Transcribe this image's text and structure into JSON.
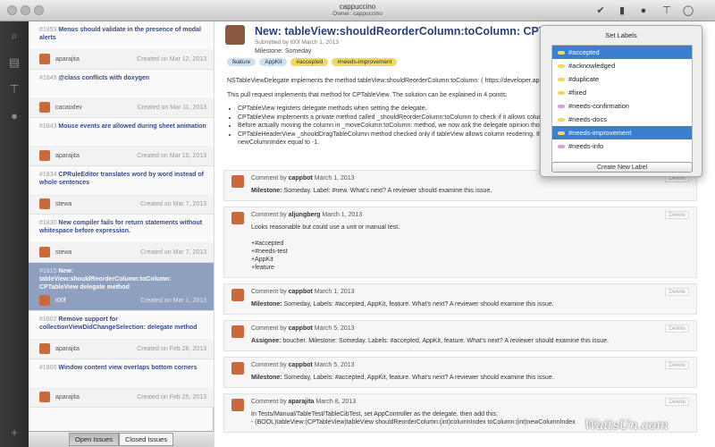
{
  "window": {
    "title": "cappuccino",
    "subtitle": "Owner: cappuccino"
  },
  "toolbar": {
    "icons": [
      "checkmark-icon",
      "tag-icon",
      "person-icon",
      "milestone-icon",
      "comment-icon"
    ]
  },
  "sidebar": {
    "icons": [
      "search-icon",
      "document-icon",
      "milestone-icon",
      "person-icon",
      "plus-icon"
    ]
  },
  "issues": [
    {
      "num": "#1853",
      "title": "Menus should validate in the presence of modal alerts",
      "author": "aparajita",
      "created": "Created on Mar 12, 2013"
    },
    {
      "num": "#1849",
      "title": "@class conflicts with doxygen",
      "author": "cacaodev",
      "created": "Created on Mar 11, 2013"
    },
    {
      "num": "#1843",
      "title": "Mouse events are allowed during sheet animation",
      "author": "aparajita",
      "created": "Created on Mar 10, 2013"
    },
    {
      "num": "#1834",
      "title": "CPRuleEditor translates word by word instead of whole sentences",
      "author": "stewa",
      "created": "Created on Mar 7, 2013"
    },
    {
      "num": "#1830",
      "title": "New compiler fails for return statements without whitespace before expression.",
      "author": "stewa",
      "created": "Created on Mar 7, 2013"
    },
    {
      "num": "#1815",
      "title": "New: tableView:shouldReorderColumn:toColumn: CPTableView delegate method",
      "author": "t00f",
      "created": "Created on Mar 1, 2013",
      "selected": true
    },
    {
      "num": "#1802",
      "title": "Remove support for collectionViewDidChangeSelection: delegate method",
      "author": "aparajita",
      "created": "Created on Feb 26, 2013"
    },
    {
      "num": "#1800",
      "title": "Window content view overlaps bottom corners",
      "author": "aparajita",
      "created": "Created on Feb 25, 2013"
    }
  ],
  "tabs": {
    "open": "Open Issues",
    "closed": "Closed Issues"
  },
  "pull": {
    "title": "New: tableView:shouldReorderColumn:toColumn: CPTableView dele",
    "submitted": "Submitted by t00f March 1, 2013",
    "milestone": "Milestone: Someday",
    "tags": [
      {
        "label": "feature",
        "color": "#cfe0f3"
      },
      {
        "label": "AppKit",
        "color": "#cfe0f3"
      },
      {
        "label": "#accepted",
        "color": "#f2d95e"
      },
      {
        "label": "#needs-improvement",
        "color": "#f2d95e"
      }
    ],
    "line1": "NSTableViewDelegate implements the method tableView:shouldReorderColumn:toColumn: ( https://developer.apple.com...",
    "line2": "This pull request implements that method for CPTableView. The solution can be explained in 4 points:",
    "points": [
      "CPTableView registers delegate methods when setting the delegate.",
      "CPTableView implements a private method called _shouldReorderColumn:toColumn to check if it allows column re... reordered.",
      "Before actually moving the column in _moveColumn:toColumn: method, we now ask the delegate opinion though...",
      "CPTableHeaderView _shouldDragTableColumn method checked only if tableView allows column reodering. It now... reordering and ask its delegate opinion with newColumnIndex equal to -1."
    ]
  },
  "comments": [
    {
      "by": "cappbot",
      "date": "March 1, 2013",
      "lead": "Milestone:",
      "text": "Someday. Label: #new. What's next? A reviewer should examine this issue."
    },
    {
      "by": "aljungberg",
      "date": "March 1, 2013",
      "lead": "",
      "text": "Looks reasonable but could use a unit or manual test.\n\n+#accepted\n+#needs-test\n+AppKit\n+feature"
    },
    {
      "by": "cappbot",
      "date": "March 1, 2013",
      "lead": "Milestone:",
      "text": "Someday, Labels: #accepted, AppKit, feature. What's next? A reviewer should examine this issue."
    },
    {
      "by": "cappbot",
      "date": "March 5, 2013",
      "lead": "Assignee:",
      "text": "boucher. Milestone: Someday. Labels: #accepted, AppKit, feature. What's next? A reviewer should examine this issue."
    },
    {
      "by": "cappbot",
      "date": "March 5, 2013",
      "lead": "Milestone:",
      "text": "Someday, Labels: #accepted, AppKit, feature. What's next? A reviewer should examine this issue."
    },
    {
      "by": "aparajita",
      "date": "March 8, 2013",
      "lead": "",
      "text": "In Tests/Manual/TableTest/TableCibTest, set AppController as the delegate, then add this:\n- (BOOL)tableView:(CPTableView)tableView shouldReorderColumn:(int)columnIndex toColumn:(int)newColumnIndex"
    }
  ],
  "comment_delete": "Delete",
  "comment_prefix": "Comment by",
  "labels": {
    "title": "Set Labels",
    "items": [
      {
        "label": "#accepted",
        "color": "#f2d95e",
        "selected": true
      },
      {
        "label": "#acknowledged",
        "color": "#f2d95e"
      },
      {
        "label": "#duplicate",
        "color": "#f2d95e"
      },
      {
        "label": "#fixed",
        "color": "#f2d95e"
      },
      {
        "label": "#needs-confirmation",
        "color": "#d8a0d8"
      },
      {
        "label": "#needs-docs",
        "color": "#f2d95e"
      },
      {
        "label": "#needs-improvement",
        "color": "#f2d95e",
        "selected": true
      },
      {
        "label": "#needs-info",
        "color": "#d8a0d8"
      }
    ],
    "create": "Create New Label"
  },
  "watermark": "WaitsUn.com"
}
